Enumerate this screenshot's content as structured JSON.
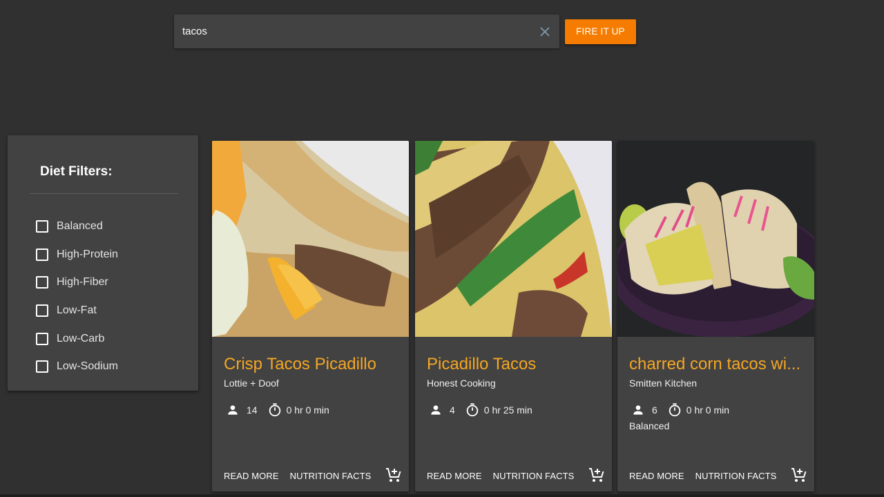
{
  "search": {
    "value": "tacos",
    "placeholder": "",
    "clear_icon": "close-icon",
    "submit_label": "FIRE IT UP"
  },
  "colors": {
    "accent": "#f57c00",
    "title": "#f5a623",
    "background": "#303030",
    "surface": "#424242"
  },
  "filters": {
    "title": "Diet Filters:",
    "items": [
      {
        "label": "Balanced",
        "checked": false
      },
      {
        "label": "High-Protein",
        "checked": false
      },
      {
        "label": "High-Fiber",
        "checked": false
      },
      {
        "label": "Low-Fat",
        "checked": false
      },
      {
        "label": "Low-Carb",
        "checked": false
      },
      {
        "label": "Low-Sodium",
        "checked": false
      }
    ]
  },
  "recipes": [
    {
      "title": "Crisp Tacos Picadillo",
      "source": "Lottie + Doof",
      "servings": "14",
      "time": "0 hr 0 min",
      "diet": "",
      "image": "crisp-tacos-photo",
      "read_more": "READ MORE",
      "nutrition": "NUTRITION FACTS",
      "cart_icon": "add-to-cart-icon"
    },
    {
      "title": "Picadillo Tacos",
      "source": "Honest Cooking",
      "servings": "4",
      "time": "0 hr 25 min",
      "diet": "",
      "image": "picadillo-tacos-photo",
      "read_more": "READ MORE",
      "nutrition": "NUTRITION FACTS",
      "cart_icon": "add-to-cart-icon"
    },
    {
      "title": "charred corn tacos wi...",
      "source": "Smitten Kitchen",
      "servings": "6",
      "time": "0 hr 0 min",
      "diet": "Balanced",
      "image": "charred-corn-tacos-photo",
      "read_more": "READ MORE",
      "nutrition": "NUTRITION FACTS",
      "cart_icon": "add-to-cart-icon"
    }
  ]
}
